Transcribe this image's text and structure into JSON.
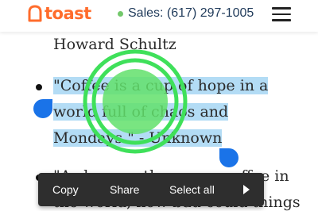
{
  "header": {
    "logo_text": "toast",
    "sales_label": "Sales: (617) 297-1005",
    "status_dot_color": "#73c86b",
    "brand_color": "#ff6c2c",
    "icons": {
      "logo": "toast-logo-icon",
      "status": "online-status-dot-icon",
      "menu": "hamburger-menu-icon"
    }
  },
  "content": {
    "attribution_line": "Howard Schultz",
    "quote1": {
      "line1": "\"Coffee is a cup of hope in a",
      "line2": "world full of chaos and",
      "line3": "Mondays.\" - Unknown"
    },
    "quote2": {
      "line1": "\"As long as there was coffee in",
      "line2": "the world, how bad could things"
    },
    "selection_color": "#b3dcf5",
    "handle_color": "#1a73e8"
  },
  "selection_toolbar": {
    "copy_label": "Copy",
    "share_label": "Share",
    "select_all_label": "Select all",
    "more_icon": "more-arrow-icon"
  },
  "overlay": {
    "tap_indicator_color": "#3fe05a",
    "tap_indicator_icon": "tap-gesture-indicator"
  }
}
